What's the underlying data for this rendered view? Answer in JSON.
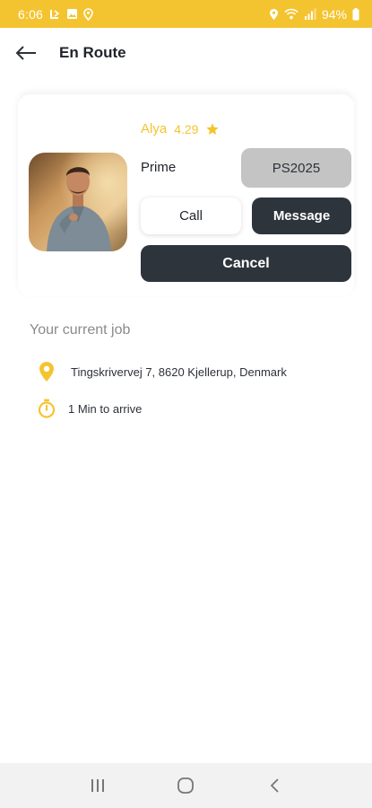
{
  "status_bar": {
    "time": "6:06",
    "battery": "94%",
    "left_icons": [
      "call-forward-icon",
      "image-icon",
      "location-icon"
    ],
    "right_icons": [
      "location-icon",
      "wifi-icon",
      "signal-icon",
      "battery-icon"
    ]
  },
  "app_bar": {
    "title": "En Route"
  },
  "driver": {
    "name": "Alya",
    "rating": "4.29",
    "vehicle_type": "Prime",
    "plate": "PS2025"
  },
  "actions": {
    "call_label": "Call",
    "message_label": "Message",
    "cancel_label": "Cancel"
  },
  "job": {
    "heading": "Your current job",
    "address": "Tingskrivervej 7, 8620 Kjellerup, Denmark",
    "arrival": "1 Min to arrive"
  },
  "colors": {
    "accent": "#f4c430",
    "dark_button": "#2d343c",
    "plate_bg": "#c4c4c4"
  }
}
